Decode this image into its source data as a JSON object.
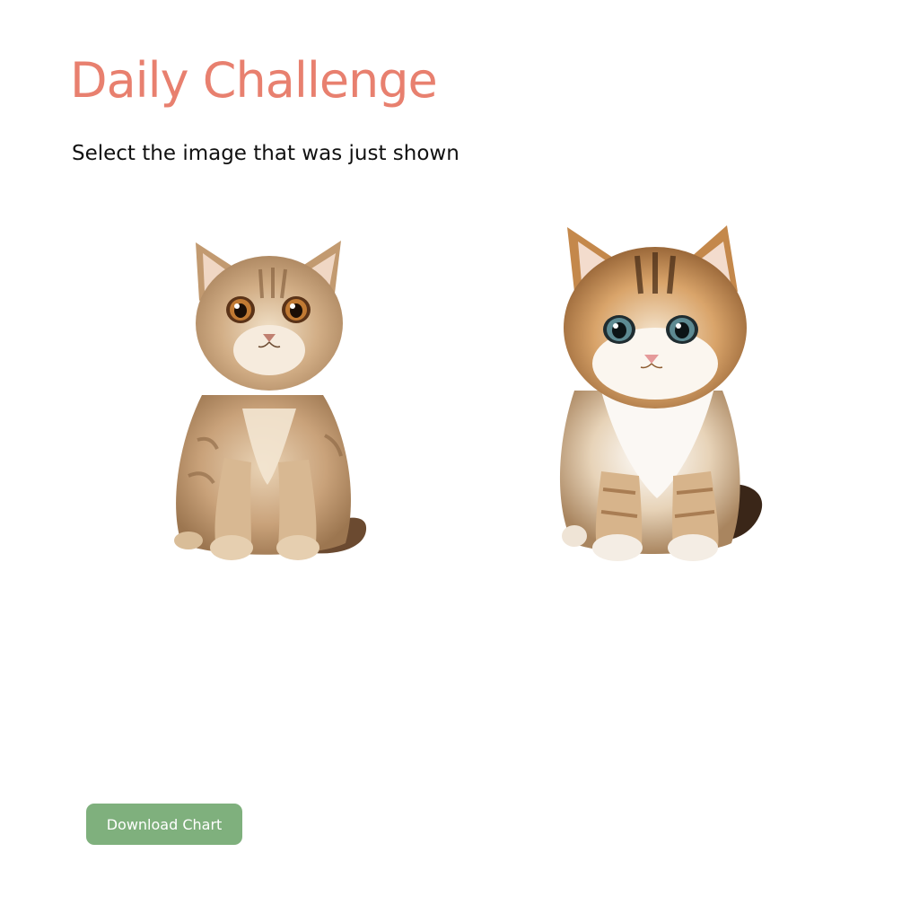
{
  "page": {
    "title": "Daily Challenge",
    "instruction": "Select the image that was just shown"
  },
  "options": [
    {
      "id": "option-1",
      "icon": "tabby-kitten-image"
    },
    {
      "id": "option-2",
      "icon": "fluffy-kitten-image"
    }
  ],
  "actions": {
    "download_label": "Download Chart"
  },
  "colors": {
    "title": "#e8806f",
    "button_bg": "#7fb07d",
    "button_text": "#ffffff",
    "text": "#111111"
  }
}
